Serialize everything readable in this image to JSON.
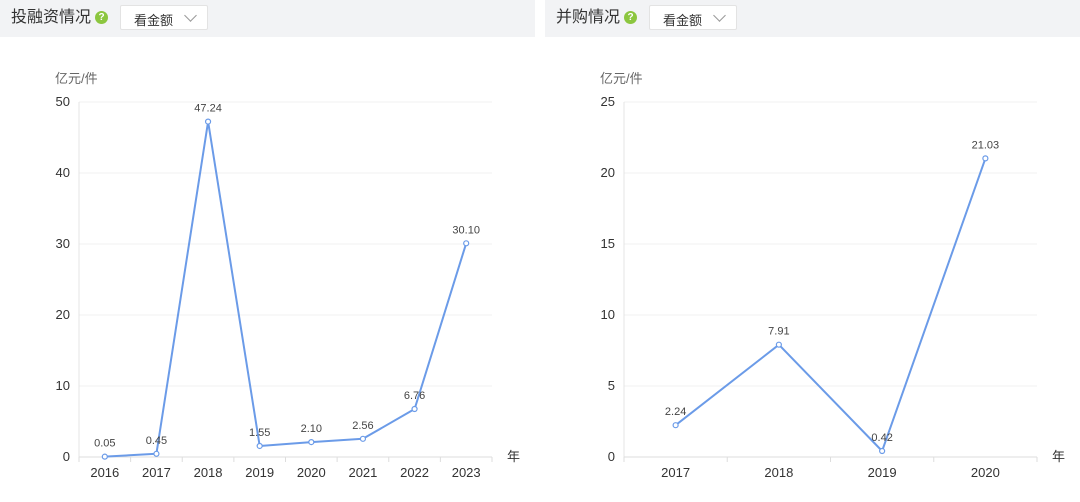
{
  "panels": [
    {
      "title": "投融资情况",
      "help_icon": "question-circle-icon",
      "dropdown_value": "看金额"
    },
    {
      "title": "并购情况",
      "help_icon": "question-circle-icon",
      "dropdown_value": "看金额"
    }
  ],
  "colors": {
    "line": "#6b9be8",
    "help_icon": "#8cc63f"
  },
  "chart_data": [
    {
      "type": "line",
      "ylabel": "亿元/件",
      "xlabel": "年",
      "categories": [
        "2016",
        "2017",
        "2018",
        "2019",
        "2020",
        "2021",
        "2022",
        "2023"
      ],
      "values": [
        0.05,
        0.45,
        47.24,
        1.55,
        2.1,
        2.56,
        6.76,
        30.1
      ],
      "data_labels": [
        "0.05",
        "0.45",
        "47.24",
        "1.55",
        "2.10",
        "2.56",
        "6.76",
        "30.10"
      ],
      "yticks": [
        "0",
        "10",
        "20",
        "30",
        "40",
        "50"
      ],
      "ylim": [
        0,
        50
      ],
      "grid": "horizontal",
      "legend": "none"
    },
    {
      "type": "line",
      "ylabel": "亿元/件",
      "xlabel": "年",
      "categories": [
        "2017",
        "2018",
        "2019",
        "2020"
      ],
      "values": [
        2.24,
        7.91,
        0.42,
        21.03
      ],
      "data_labels": [
        "2.24",
        "7.91",
        "0.42",
        "21.03"
      ],
      "yticks": [
        "0",
        "5",
        "10",
        "15",
        "20",
        "25"
      ],
      "ylim": [
        0,
        25
      ],
      "grid": "horizontal",
      "legend": "none"
    }
  ]
}
